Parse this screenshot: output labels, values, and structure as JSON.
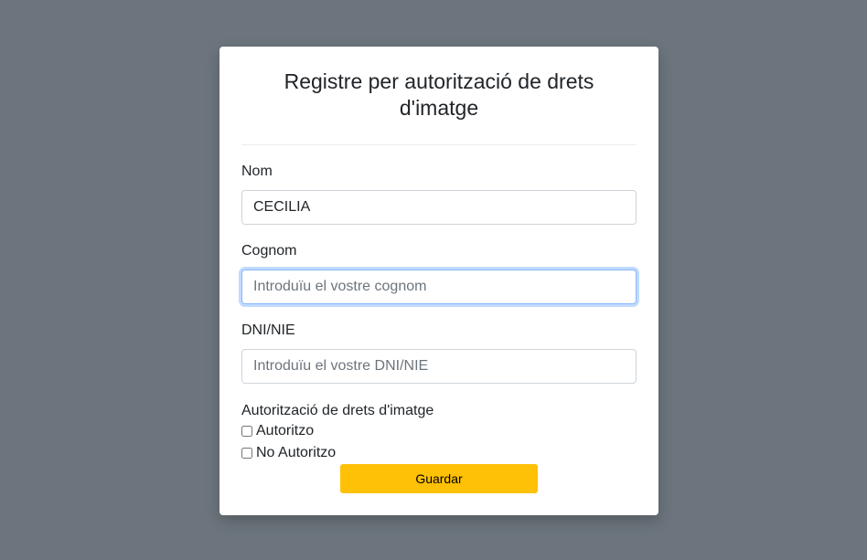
{
  "form": {
    "title": "Registre per autorització de drets d'imatge",
    "fields": [
      {
        "label": "Nom",
        "value": "CECILIA",
        "placeholder": ""
      },
      {
        "label": "Cognom",
        "value": "",
        "placeholder": "Introduïu el vostre cognom"
      },
      {
        "label": "DNI/NIE",
        "value": "",
        "placeholder": "Introduïu el vostre DNI/NIE"
      }
    ],
    "authorization": {
      "label": "Autorització de drets d'imatge",
      "options": [
        "Autoritzo",
        "No Autoritzo"
      ]
    },
    "save_label": "Guardar"
  },
  "colors": {
    "background": "#6c757d",
    "card": "#ffffff",
    "button": "#ffc107",
    "focus_border": "#86b7fe"
  }
}
